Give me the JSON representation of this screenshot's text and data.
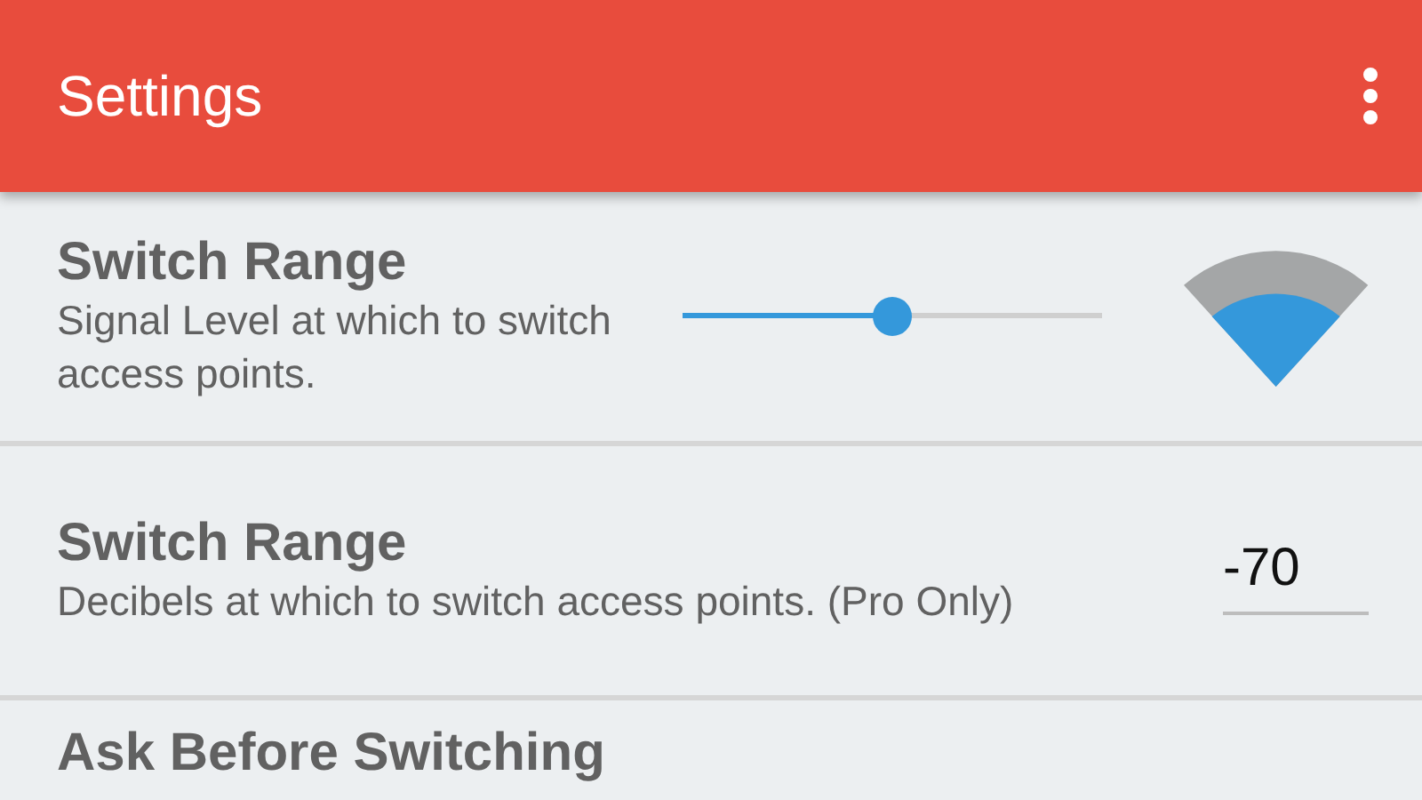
{
  "app_bar": {
    "title": "Settings"
  },
  "settings": [
    {
      "kind": "slider",
      "title": "Switch Range",
      "description": "Signal Level at which to switch access points.",
      "level": 0.5
    },
    {
      "kind": "number",
      "title": "Switch Range",
      "description": "Decibels at which to switch access points. (Pro Only)",
      "value": "-70"
    },
    {
      "kind": "plain",
      "title": "Ask Before Switching"
    }
  ]
}
